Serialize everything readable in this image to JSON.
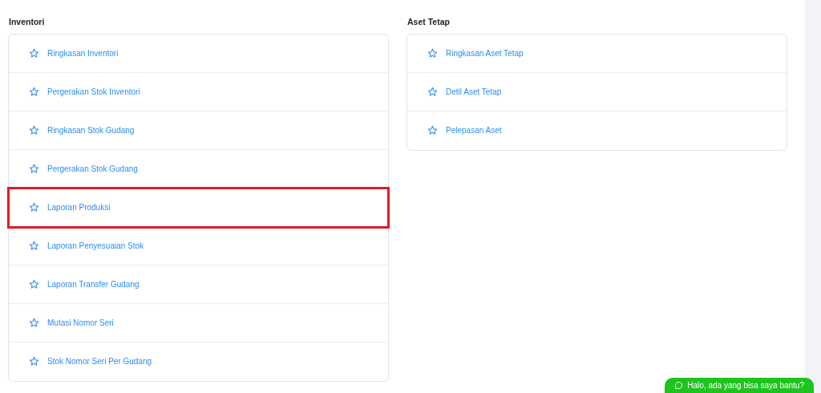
{
  "sections": [
    {
      "title": "Inventori",
      "items": [
        {
          "label": "Ringkasan Inventori",
          "highlighted": false
        },
        {
          "label": "Pergerakan Stok Inventori",
          "highlighted": false
        },
        {
          "label": "Ringkasan Stok Gudang",
          "highlighted": false
        },
        {
          "label": "Pergerakan Stok Gudang",
          "highlighted": false
        },
        {
          "label": "Laporan Produksi",
          "highlighted": true
        },
        {
          "label": "Laporan Penyesuaian Stok",
          "highlighted": false
        },
        {
          "label": "Laporan Transfer Gudang",
          "highlighted": false
        },
        {
          "label": "Mutasi Nomor Seri",
          "highlighted": false
        },
        {
          "label": "Stok Nomor Seri Per Gudang",
          "highlighted": false
        }
      ]
    },
    {
      "title": "Aset Tetap",
      "items": [
        {
          "label": "Ringkasan Aset Tetap",
          "highlighted": false
        },
        {
          "label": "Detil Aset Tetap",
          "highlighted": false
        },
        {
          "label": "Pelepasan Aset",
          "highlighted": false
        }
      ]
    }
  ],
  "chat_button": {
    "label": "Halo, ada yang bisa saya bantu?"
  }
}
